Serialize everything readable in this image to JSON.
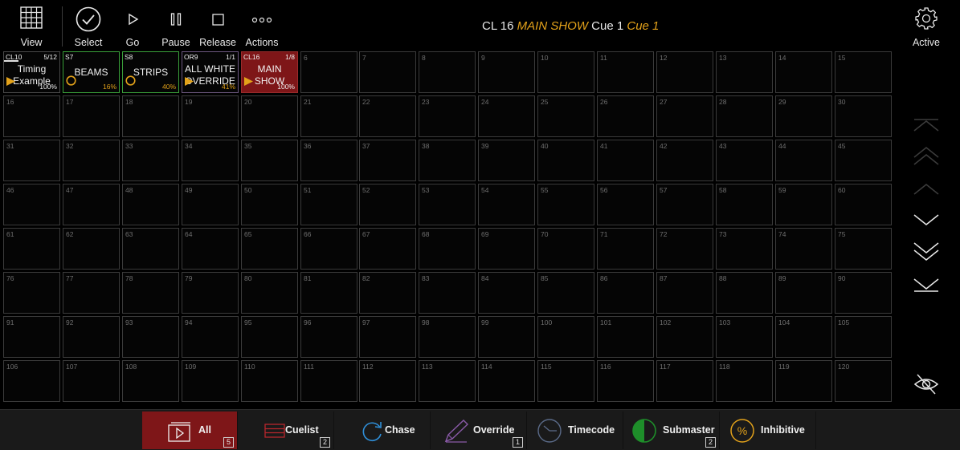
{
  "toolbar": {
    "view": "View",
    "select": "Select",
    "go": "Go",
    "pause": "Pause",
    "release": "Release",
    "actions": "Actions"
  },
  "status": {
    "cuelist_prefix": "CL 16",
    "cuelist_name": "MAIN SHOW",
    "cue_prefix": "Cue 1",
    "cue_name": "Cue 1"
  },
  "settings": {
    "label": "Active"
  },
  "playbacks": [
    {
      "tag": "CL10",
      "count": "5/12",
      "name": [
        "Timing",
        "Example"
      ],
      "pct": "100%",
      "style": "white",
      "mark": "play"
    },
    {
      "tag": "S7",
      "count": "",
      "name": [
        "BEAMS"
      ],
      "pct": "16%",
      "style": "green",
      "mark": "circle"
    },
    {
      "tag": "S8",
      "count": "",
      "name": [
        "STRIPS"
      ],
      "pct": "40%",
      "style": "green",
      "mark": "circle"
    },
    {
      "tag": "OR9",
      "count": "1/1",
      "name": [
        "ALL WHITE",
        "OVERRIDE"
      ],
      "pct": "41%",
      "style": "purple",
      "mark": "play"
    },
    {
      "tag": "CL16",
      "count": "1/8",
      "name": [
        "MAIN",
        "SHOW"
      ],
      "pct": "100%",
      "style": "red",
      "mark": "play"
    }
  ],
  "empty_numbers": [
    "6",
    "7",
    "8",
    "9",
    "10",
    "11",
    "12",
    "13",
    "14",
    "15",
    "16",
    "17",
    "18",
    "19",
    "20",
    "21",
    "22",
    "23",
    "24",
    "25",
    "26",
    "27",
    "28",
    "29",
    "30",
    "31",
    "32",
    "33",
    "34",
    "35",
    "36",
    "37",
    "38",
    "39",
    "40",
    "41",
    "42",
    "43",
    "44",
    "45",
    "46",
    "47",
    "48",
    "49",
    "50",
    "51",
    "52",
    "53",
    "54",
    "55",
    "56",
    "57",
    "58",
    "59",
    "60",
    "61",
    "62",
    "63",
    "64",
    "65",
    "66",
    "67",
    "68",
    "69",
    "70",
    "71",
    "72",
    "73",
    "74",
    "75",
    "76",
    "77",
    "78",
    "79",
    "80",
    "81",
    "82",
    "83",
    "84",
    "85",
    "86",
    "87",
    "88",
    "89",
    "90",
    "91",
    "92",
    "93",
    "94",
    "95",
    "96",
    "97",
    "98",
    "99",
    "100",
    "101",
    "102",
    "103",
    "104",
    "105",
    "106",
    "107",
    "108",
    "109",
    "110",
    "111",
    "112",
    "113",
    "114",
    "115",
    "116",
    "117",
    "118",
    "119",
    "120"
  ],
  "bottom_tabs": [
    {
      "label": "All",
      "count": "5",
      "icon": "play-box-icon"
    },
    {
      "label": "Cuelist",
      "count": "2",
      "icon": "cuelist-icon"
    },
    {
      "label": "Chase",
      "count": "",
      "icon": "chase-refresh-icon"
    },
    {
      "label": "Override",
      "count": "1",
      "icon": "override-pen-icon"
    },
    {
      "label": "Timecode",
      "count": "",
      "icon": "timecode-clock-icon"
    },
    {
      "label": "Submaster",
      "count": "2",
      "icon": "submaster-half-circle-icon"
    },
    {
      "label": "Inhibitive",
      "count": "",
      "icon": "inhibitive-percent-icon"
    }
  ],
  "colors": {
    "accent_gold": "#e3a21a",
    "active_red": "#7e1618",
    "submaster_green": "#3aa03a",
    "override_purple": "#6d5880",
    "pct_gold": "#e3a21a",
    "pct_green": "#9acd32"
  }
}
